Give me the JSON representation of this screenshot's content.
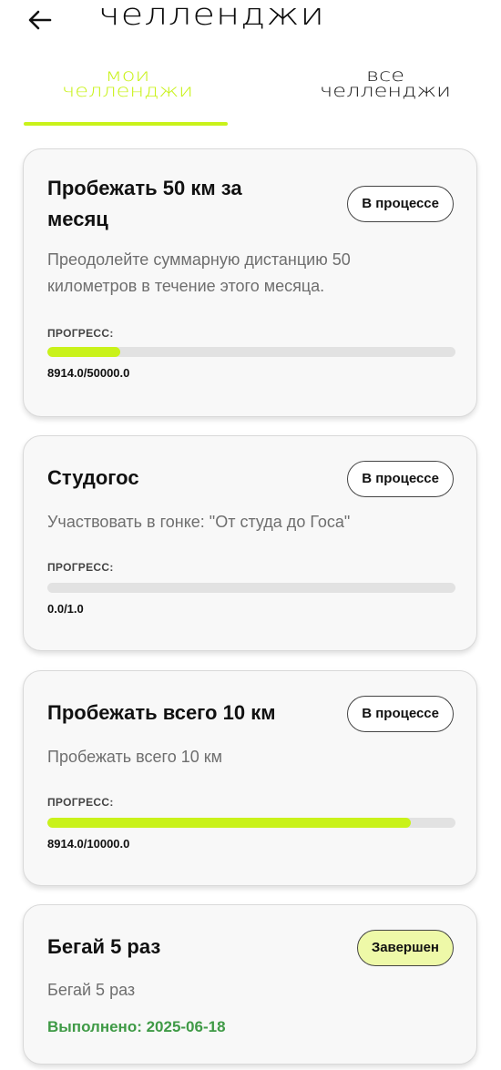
{
  "header": {
    "back_icon": "arrow-left-icon",
    "title": "челленджи"
  },
  "tabs": [
    {
      "line1": "мои",
      "line2": "челленджи",
      "active": true
    },
    {
      "line1": "все",
      "line2": "челленджи",
      "active": false
    }
  ],
  "colors": {
    "accent": "#c9f21a",
    "completed_text": "#3f9a46",
    "completed_badge_bg": "#eef9a8"
  },
  "challenges": [
    {
      "title_line1": "Пробежать 50 км за",
      "title_line2": "месяц",
      "status": "В процессе",
      "desc_line1": "Преодолейте суммарную дистанцию 50",
      "desc_line2": "километров в течение этого месяца.",
      "progress_label": "ПРОГРЕСС:",
      "progress_fraction": 0.17828,
      "progress_text": "8914.0/50000.0"
    },
    {
      "title_line1": "Студогос",
      "status": "В процессе",
      "desc_line1": "Участвовать в гонке: \"От студа до Госа\"",
      "progress_label": "ПРОГРЕСС:",
      "progress_fraction": 0.0,
      "progress_text": "0.0/1.0"
    },
    {
      "title_line1": "Пробежать всего 10 км",
      "status": "В процессе",
      "desc_line1": "Пробежать всего 10 км",
      "progress_label": "ПРОГРЕСС:",
      "progress_fraction": 0.8914,
      "progress_text": "8914.0/10000.0"
    },
    {
      "title_line1": "Бегай 5 раз",
      "status": "Завершен",
      "desc_line1": "Бегай 5 раз",
      "completed_text": "Выполнено: 2025-06-18"
    }
  ]
}
